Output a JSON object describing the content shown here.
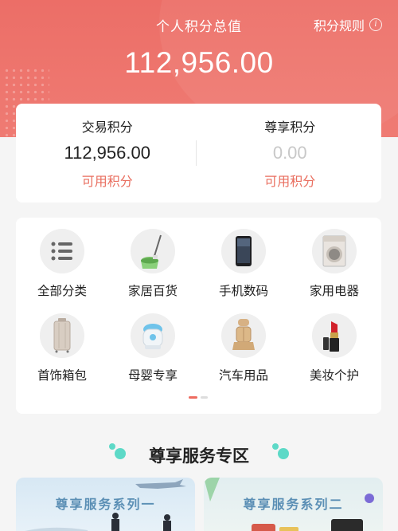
{
  "header": {
    "title": "个人积分总值",
    "rules_label": "积分规则",
    "total": "112,956.00",
    "bg_color": "#ec6e67"
  },
  "points": {
    "trade": {
      "label": "交易积分",
      "value": "112,956.00",
      "sub": "可用积分"
    },
    "vip": {
      "label": "尊享积分",
      "value": "0.00",
      "sub": "可用积分"
    }
  },
  "categories": [
    {
      "label": "全部分类",
      "icon": "list-icon"
    },
    {
      "label": "家居百货",
      "icon": "mop-bucket-icon"
    },
    {
      "label": "手机数码",
      "icon": "smartphone-icon"
    },
    {
      "label": "家用电器",
      "icon": "washing-machine-icon"
    },
    {
      "label": "首饰箱包",
      "icon": "suitcase-icon"
    },
    {
      "label": "母婴专享",
      "icon": "baby-bottle-sterilizer-icon"
    },
    {
      "label": "汽车用品",
      "icon": "car-seat-icon"
    },
    {
      "label": "美妆个护",
      "icon": "lipstick-icon"
    }
  ],
  "pager": {
    "current": 1,
    "total": 2
  },
  "section": {
    "title": "尊享服务专区",
    "accent": "#5dd9c7"
  },
  "banners": [
    {
      "title": "尊享服务系列一"
    },
    {
      "title": "尊享服务系列二"
    }
  ]
}
